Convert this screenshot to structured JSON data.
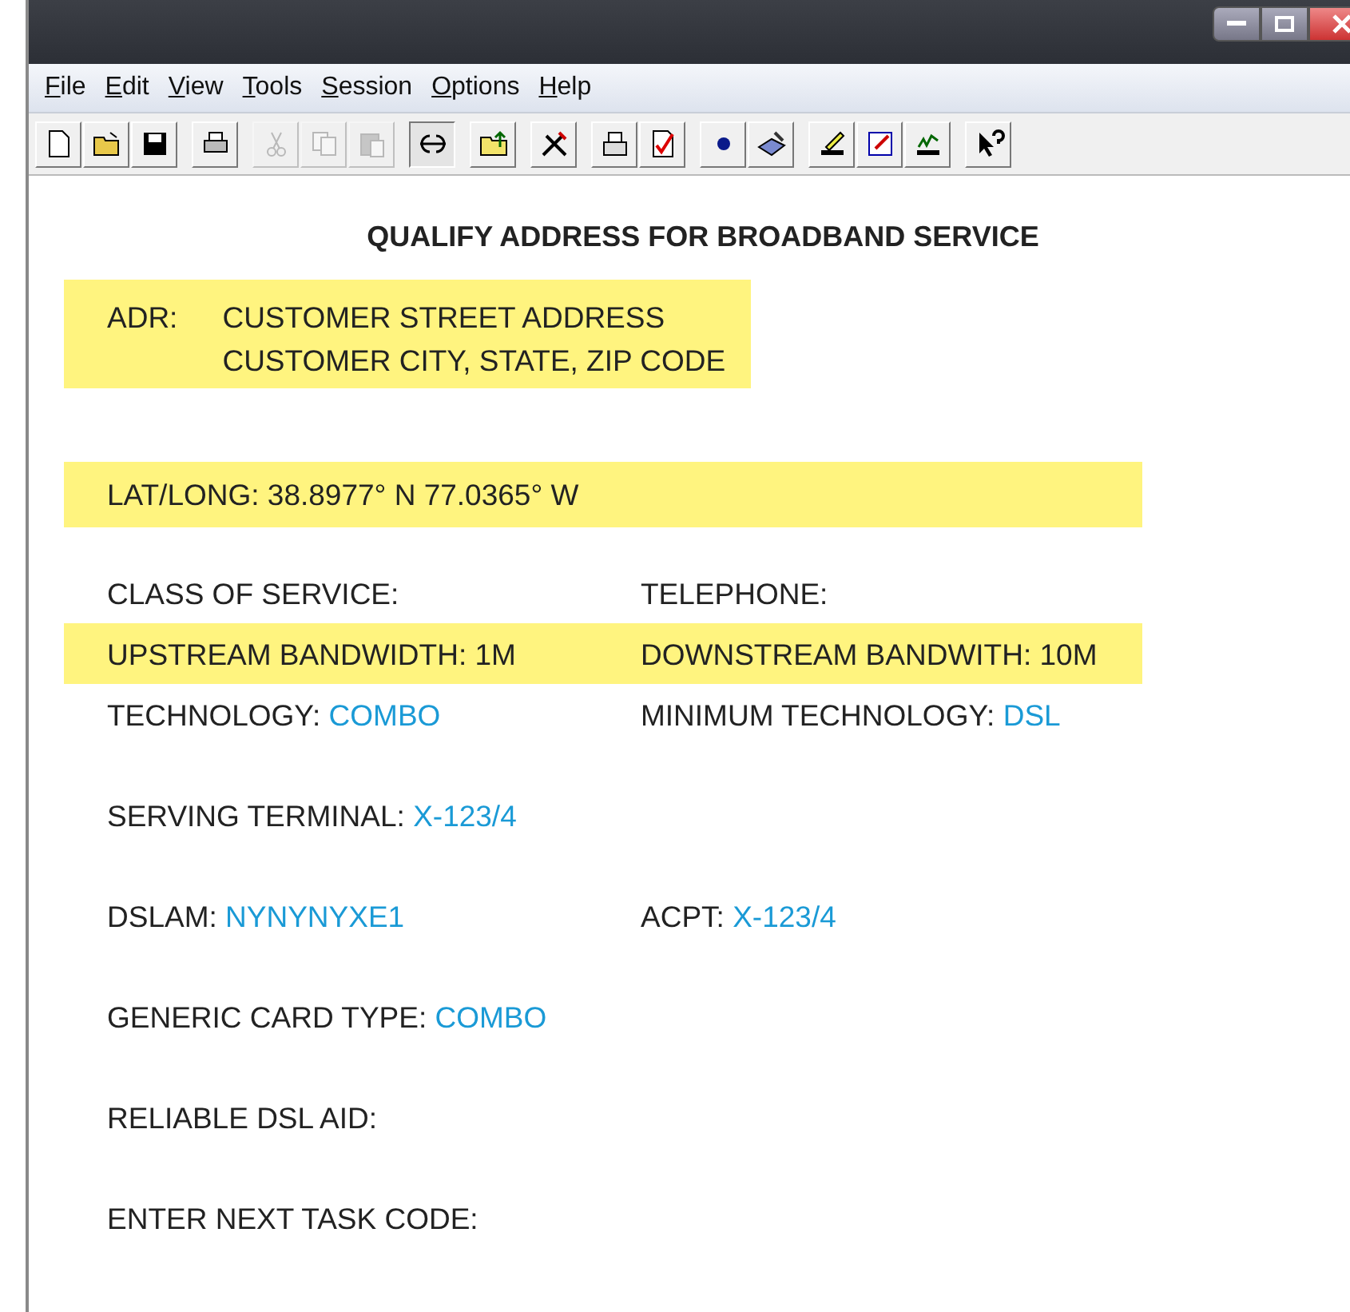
{
  "menu": [
    {
      "label": "File"
    },
    {
      "label": "Edit"
    },
    {
      "label": "View"
    },
    {
      "label": "Tools"
    },
    {
      "label": "Session"
    },
    {
      "label": "Options"
    },
    {
      "label": "Help"
    }
  ],
  "toolbar": [
    [
      {
        "disabled": false,
        "pressed": false
      },
      {
        "disabled": false,
        "pressed": false
      },
      {
        "disabled": false,
        "pressed": false
      }
    ],
    [
      {
        "disabled": false,
        "pressed": false
      }
    ],
    [
      {
        "disabled": true,
        "pressed": false
      },
      {
        "disabled": true,
        "pressed": false
      },
      {
        "disabled": true,
        "pressed": false
      }
    ],
    [
      {
        "disabled": false,
        "pressed": true
      }
    ],
    [
      {
        "disabled": false,
        "pressed": false
      }
    ],
    [
      {
        "disabled": false,
        "pressed": false
      }
    ],
    [
      {
        "disabled": false,
        "pressed": false
      },
      {
        "disabled": false,
        "pressed": false
      }
    ],
    [
      {
        "disabled": false,
        "pressed": false
      },
      {
        "disabled": false,
        "pressed": false
      }
    ],
    [
      {
        "disabled": false,
        "pressed": false
      },
      {
        "disabled": false,
        "pressed": false
      },
      {
        "disabled": false,
        "pressed": false
      }
    ],
    [
      {
        "disabled": false,
        "pressed": false
      }
    ]
  ],
  "screen": {
    "title": "QUALIFY ADDRESS FOR BROADBAND SERVICE",
    "address": {
      "label": "ADR:",
      "lines": [
        "CUSTOMER STREET ADDRESS",
        "CUSTOMER CITY, STATE, ZIP CODE"
      ],
      "highlighted": true
    },
    "location": {
      "label": "LAT/LONG:",
      "value": "38.8977° N 77.0365° W",
      "highlighted": true
    },
    "rows": [
      {
        "highlighted": false,
        "cells": [
          {
            "label": "CLASS OF SERVICE:"
          },
          {
            "label": "TELEPHONE:"
          }
        ]
      },
      {
        "highlighted": true,
        "cells": [
          {
            "label": "UPSTREAM BANDWIDTH: 1M"
          },
          {
            "label": "DOWNSTREAM BANDWITH: 10M"
          }
        ]
      },
      {
        "highlighted": false,
        "cells": [
          {
            "label": "TECHNOLOGY:",
            "value": "COMBO"
          },
          {
            "label": "MINIMUM TECHNOLOGY:",
            "value": "DSL"
          }
        ]
      },
      {
        "highlighted": false,
        "cells": [
          {
            "label": "SERVING TERMINAL:",
            "value": "X-123/4"
          }
        ]
      },
      {
        "highlighted": false,
        "cells": [
          {
            "label": "DSLAM:",
            "value": "NYNYNYXE1"
          },
          {
            "label": "ACPT:",
            "value": "X-123/4"
          }
        ]
      },
      {
        "highlighted": false,
        "cells": [
          {
            "label": "GENERIC CARD TYPE:",
            "value": "COMBO"
          }
        ]
      },
      {
        "highlighted": false,
        "cells": [
          {
            "label": "RELIABLE DSL AID:"
          }
        ]
      },
      {
        "highlighted": false,
        "cells": [
          {
            "label": "ENTER NEXT TASK CODE:"
          }
        ]
      }
    ]
  }
}
